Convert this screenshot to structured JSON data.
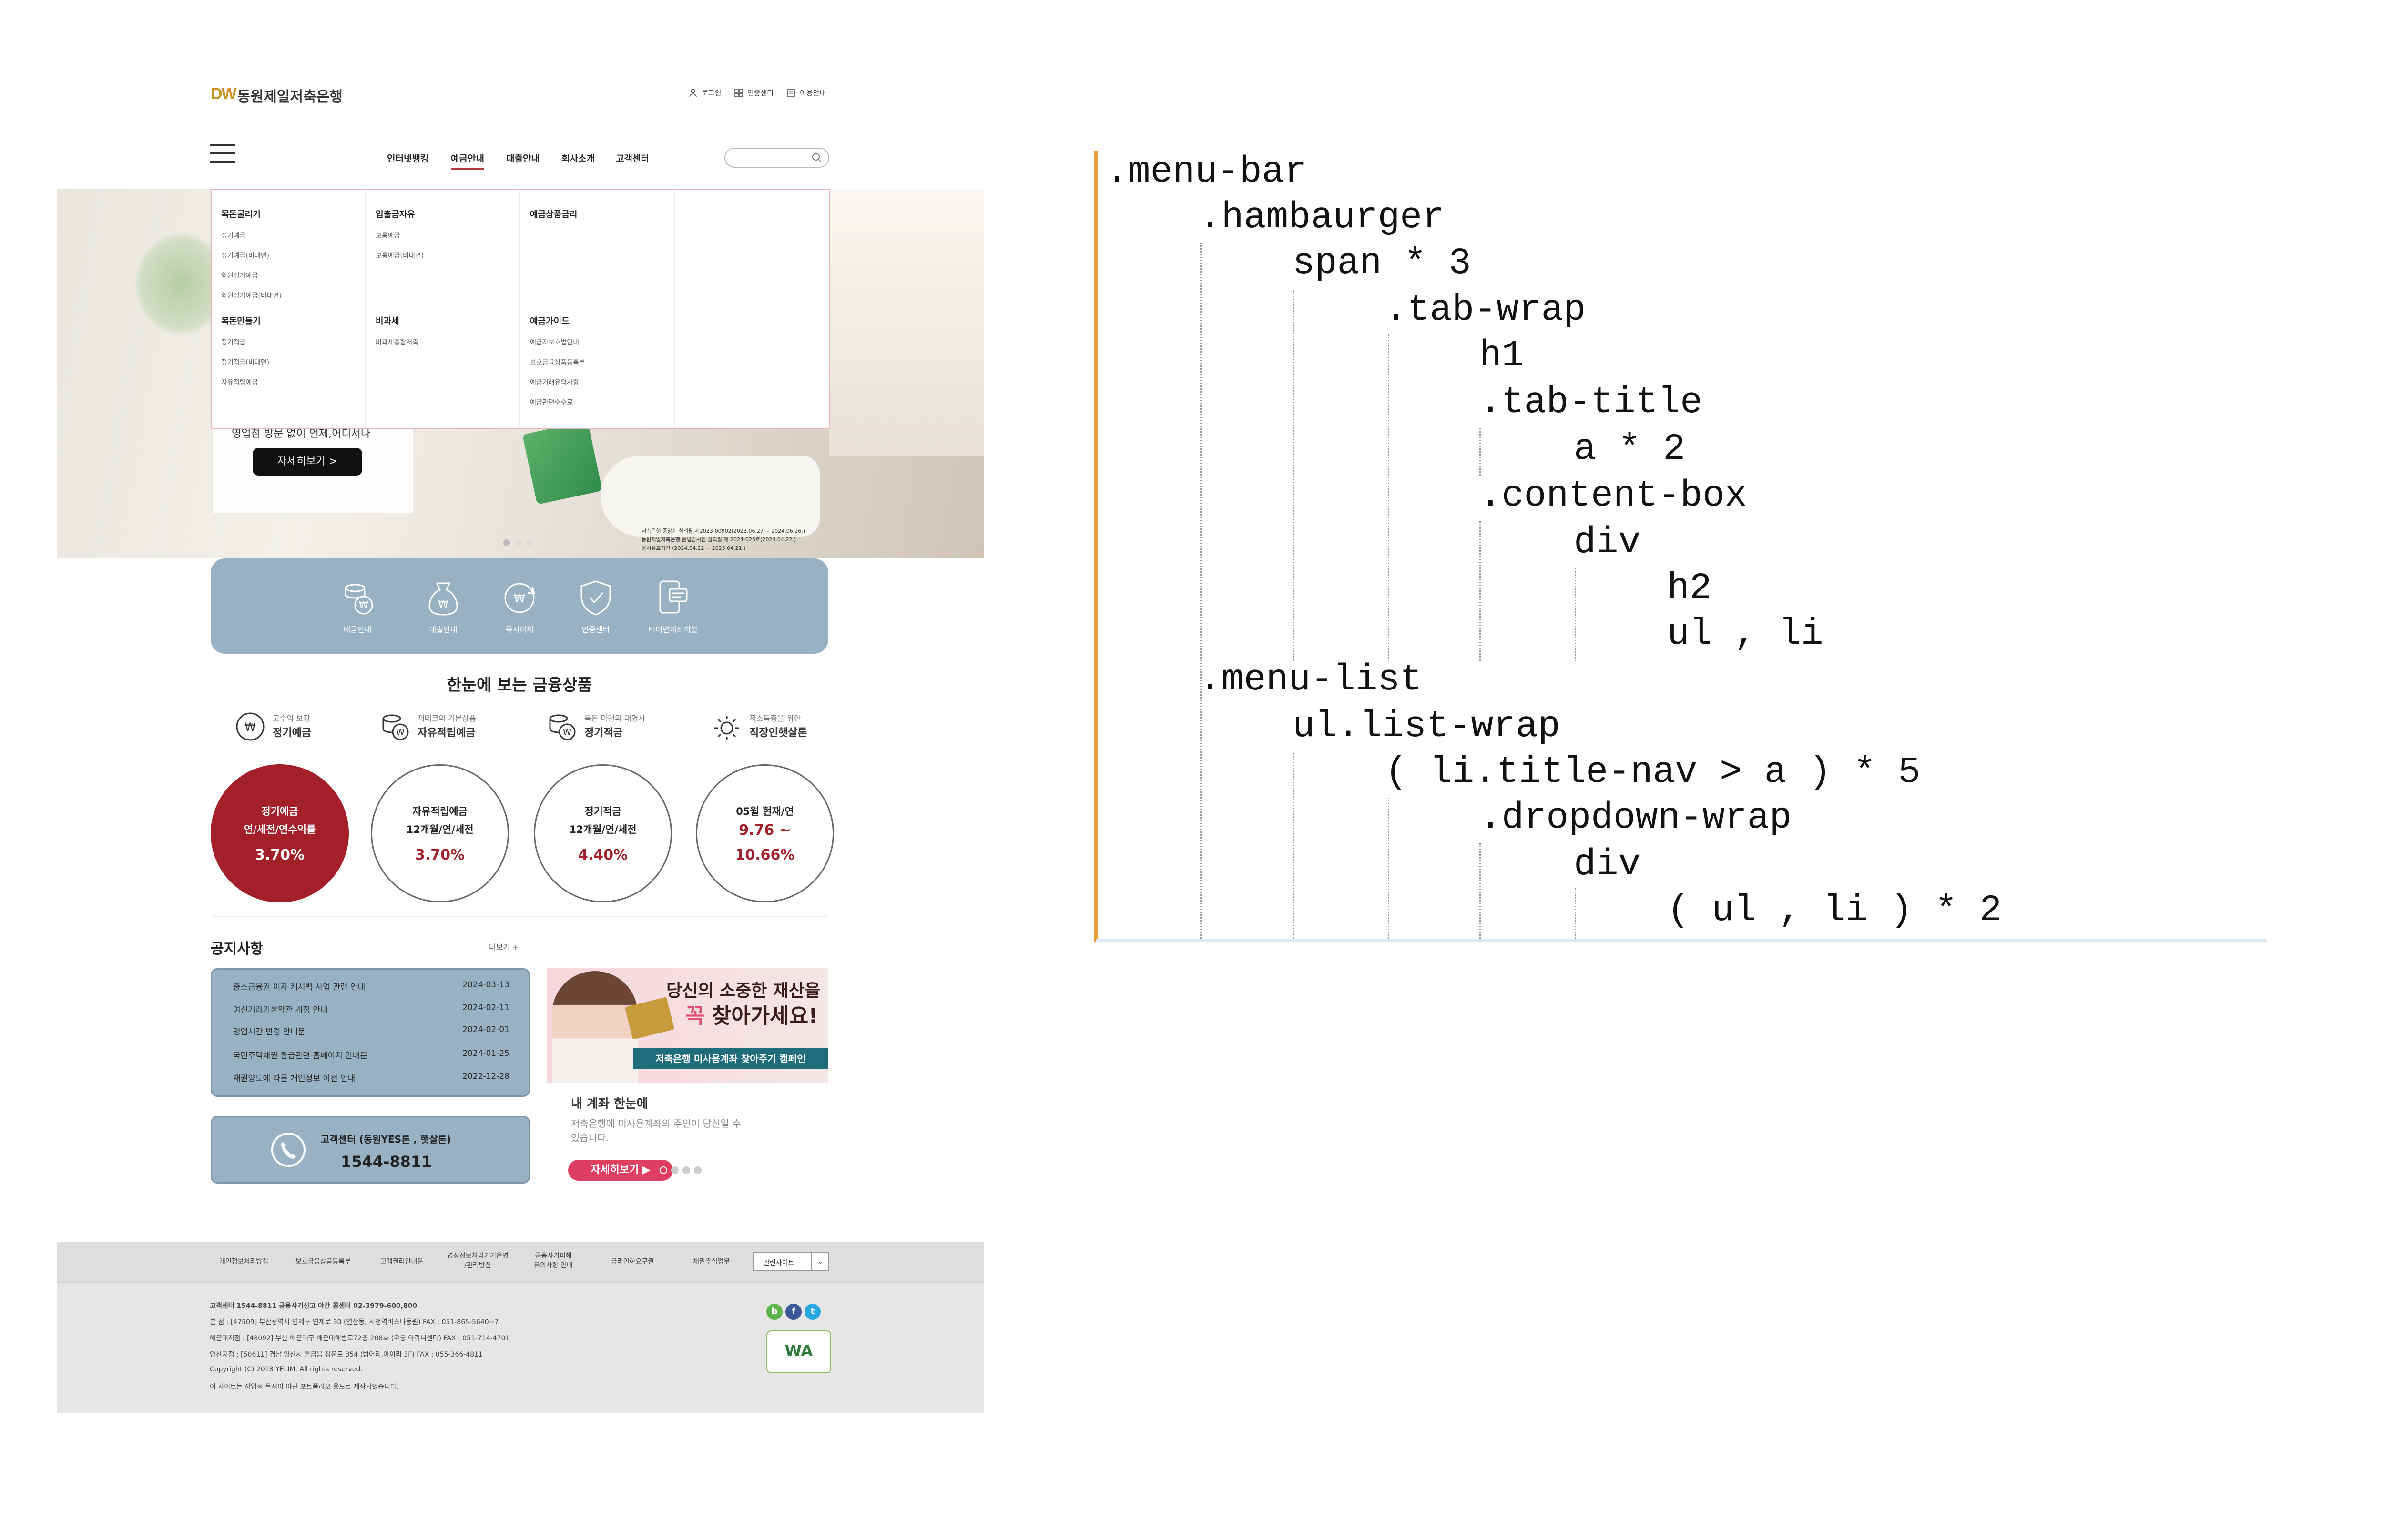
{
  "site": {
    "logo_mark": "DW",
    "logo_text": "동원제일저축은행",
    "util_links": [
      "로그인",
      "인증센터",
      "이용안내"
    ],
    "gnb": [
      "인터넷뱅킹",
      "예금안내",
      "대출안내",
      "회사소개",
      "고객센터"
    ],
    "gnb_active_index": 1,
    "mega_menu": {
      "columns": [
        {
          "title": "목돈굴리기",
          "items": [
            "정기예금",
            "정기예금(비대면)",
            "회원정기예금",
            "회원정기예금(비대면)"
          ]
        },
        {
          "title": "입출금자유",
          "items": [
            "보통예금",
            "보통예금(비대면)"
          ]
        },
        {
          "title": "예금상품금리",
          "items": []
        },
        {
          "title": "목돈만들기",
          "items": [
            "정기적금",
            "정기적금(비대면)",
            "자유적립예금"
          ]
        },
        {
          "title": "비과세",
          "items": [
            "비과세종합저축"
          ]
        },
        {
          "title": "예금가이드",
          "items": [
            "예금자보호법안내",
            "보호금융상품등록부",
            "예금거래유의사항",
            "예금관련수수료"
          ]
        }
      ]
    },
    "hero": {
      "text": "영업점 방문 없이 언제,어디서나",
      "button": "자세히보기 >",
      "fine_print": [
        "저축은행 중앙회 심의필 제2023-00902(2023.06.27 ~ 2024.06.26.)",
        "동원제일저축은행 준법감시인 심의필 제 2024-025호(2024.04.22.)",
        "공시유효기간 (2024.04.22 ~ 2025.04.21.)"
      ]
    },
    "quick_menu": [
      {
        "label": "예금안내",
        "icon": "deposit-icon"
      },
      {
        "label": "대출안내",
        "icon": "loan-bag-icon"
      },
      {
        "label": "즉시이체",
        "icon": "transfer-icon"
      },
      {
        "label": "인증센터",
        "icon": "shield-check-icon"
      },
      {
        "label": "비대면계좌개설",
        "icon": "mobile-account-icon"
      }
    ],
    "products_title": "한눈에 보는 금융상품",
    "products": [
      {
        "label": "고수익 보장",
        "name": "정기예금"
      },
      {
        "label": "재테크의 기본상품",
        "name": "자유적립예금"
      },
      {
        "label": "목돈 마련의 대명사",
        "name": "정기적금"
      },
      {
        "label": "저소득층을 위한",
        "name": "직장인햇살론"
      }
    ],
    "rates": [
      {
        "line1": "정기예금",
        "line2": "연/세전/연수익률",
        "rate": "3.70%"
      },
      {
        "line1": "자유적립예금",
        "line2": "12개월/연/세전",
        "rate": "3.70%"
      },
      {
        "line1": "정기적금",
        "line2": "12개월/연/세전",
        "rate": "4.40%"
      },
      {
        "line1": "05월 현재/연",
        "line2": "9.76 ~",
        "rate": "10.66%"
      }
    ],
    "notice": {
      "title": "공지사항",
      "more": "더보기 +",
      "rows": [
        {
          "title": "중소금융권 이자 캐시백 사업 관련 안내",
          "date": "2024-03-13"
        },
        {
          "title": "여신거래기본약관 개정 안내",
          "date": "2024-02-11"
        },
        {
          "title": "영업시간 변경 안내문",
          "date": "2024-02-01"
        },
        {
          "title": "국민주택채권 환급관련 홈페이지 안내문",
          "date": "2024-01-25"
        },
        {
          "title": "채권양도에 따른 개인정보 이전 안내",
          "date": "2022-12-28"
        }
      ]
    },
    "call_center": {
      "label": "고객센터 (동원YES론 , 햇살론)",
      "number": "1544-8811"
    },
    "banner": {
      "headline1": "당신의 소중한 재산을",
      "headline2a": "꼭",
      "headline2b": " 찾아가세요!",
      "ribbon": "저축은행 미사용계좌 찾아주기 캠페인",
      "sub_title": "내 계좌 한눈에",
      "sub_desc1": "저축은행에 미사용계좌의 주인이 당신일 수",
      "sub_desc2": "있습니다.",
      "button": "자세히보기 ▶"
    },
    "footer_nav": [
      "개인정보처리방침",
      "보호금융상품등록부",
      "고객권리안내문",
      "영상정보처리기기운영\n/관리방침",
      "금융사기피해\n유의사항 안내",
      "금리인하요구권",
      "채권추심업무"
    ],
    "family_site": "관련사이트",
    "footer_lines": [
      "고객센터  1544-8811       금융사기신고 야간 콜센터  02-3979-600,800",
      "본 점 : [47509] 부산광역시 연제구 연제로 30 (연산동, 시청역비스타동원)       FAX : 051-865-5640~7",
      "해운대지점 : [48092] 부산 해운대구 해운대해변로72층 208호 (우동,아라니센터)       FAX : 051-714-4701",
      "양산지점 : [50611] 경남 양산시 물금읍 청운로 354 (범어리,아이리 3F)       FAX : 055-366-4811",
      "Copyright (C) 2018 YELIM. All rights reserved.",
      "이 사이트는 상업적 목적이 아닌 포트폴리오 용도로 제작되었습니다."
    ],
    "wa_badge": "WA"
  },
  "code_lines": [
    ".menu-bar",
    ".hambaurger",
    "span * 3",
    ".tab-wrap",
    "h1",
    ".tab-title",
    "a * 2",
    ".content-box",
    "div",
    "h2",
    "ul , li",
    ".menu-list",
    "ul.list-wrap",
    "( li.title-nav > a ) * 5",
    ".dropdown-wrap",
    "div",
    "( ul , li ) * 2"
  ],
  "colors": {
    "accent": "#a3202a",
    "quick": "#98b2c3",
    "logo": "#c9901c",
    "banner_btn": "#dd3e62",
    "code_border": "#e8a13a"
  }
}
